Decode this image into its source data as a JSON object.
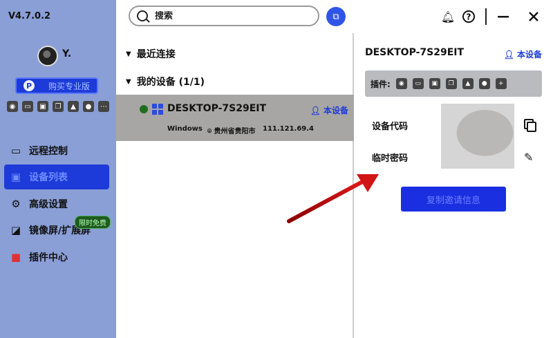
{
  "app": {
    "version": "V4.7.0.2"
  },
  "user": {
    "name": "Y."
  },
  "sidebar": {
    "buy_label": "购买专业版",
    "buy_icon_letter": "P",
    "quick_icons": [
      "gamepad-icon",
      "monitor-icon",
      "screen-icon",
      "window-icon",
      "rocket-icon",
      "record-icon",
      "more-icon"
    ],
    "nav": [
      {
        "label": "远程控制",
        "icon": "remote-control-icon",
        "active": false
      },
      {
        "label": "设备列表",
        "icon": "device-list-icon",
        "active": true
      },
      {
        "label": "高级设置",
        "icon": "settings-icon",
        "active": false
      },
      {
        "label": "镜像屏/扩展屏",
        "icon": "mirror-screen-icon",
        "active": false,
        "badge": "限时免费"
      },
      {
        "label": "插件中心",
        "icon": "plugin-center-icon",
        "active": false
      }
    ]
  },
  "topbar": {
    "search_placeholder": "搜索"
  },
  "device_list": {
    "recent_group": "最近连接",
    "my_devices_group": "我的设备 (1/1)",
    "device": {
      "name": "DESKTOP-7S29EIT",
      "this_device_label": "本设备",
      "os": "Windows",
      "location": "贵州省贵阳市",
      "ip": "111.121.69.4",
      "online": true,
      "status_color": "#1f6e1f"
    }
  },
  "detail": {
    "title": "DESKTOP-7S29EIT",
    "this_device_label": "本设备",
    "plugins_label": "插件:",
    "plugin_icons": [
      "gamepad-icon",
      "monitor-icon",
      "screen-icon",
      "window-icon",
      "rocket-icon",
      "record-icon",
      "add-icon"
    ],
    "device_code_label": "设备代码",
    "temp_password_label": "临时密码",
    "copy_invite_label": "复制邀请信息"
  },
  "colors": {
    "accent": "#1d3bd8",
    "sidebar_bg": "#8a9fd6",
    "selected_row": "#a8a6a4",
    "annotation_arrow": "#cc1111"
  }
}
